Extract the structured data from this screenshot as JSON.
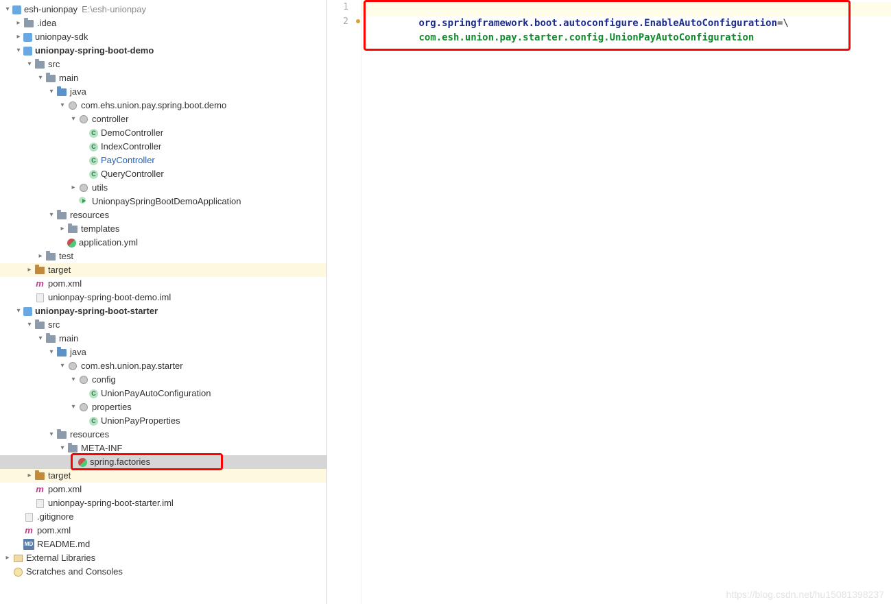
{
  "project": {
    "root_name": "esh-unionpay",
    "root_path": "E:\\esh-unionpay",
    "idea": ".idea",
    "sdk": "unionpay-sdk",
    "demo": "unionpay-spring-boot-demo",
    "src": "src",
    "main": "main",
    "java": "java",
    "pkg_demo": "com.ehs.union.pay.spring.boot.demo",
    "controller": "controller",
    "demo_ctl": "DemoController",
    "index_ctl": "IndexController",
    "pay_ctl": "PayController",
    "query_ctl": "QueryController",
    "utils": "utils",
    "demo_app": "UnionpaySpringBootDemoApplication",
    "resources": "resources",
    "templates": "templates",
    "app_yml": "application.yml",
    "test": "test",
    "target": "target",
    "pom": "pom.xml",
    "demo_iml": "unionpay-spring-boot-demo.iml",
    "starter": "unionpay-spring-boot-starter",
    "pkg_starter": "com.esh.union.pay.starter",
    "config": "config",
    "auto_cfg": "UnionPayAutoConfiguration",
    "properties": "properties",
    "union_props": "UnionPayProperties",
    "metainf": "META-INF",
    "spring_fac": "spring.factories",
    "starter_iml": "unionpay-spring-boot-starter.iml",
    "gitignore": ".gitignore",
    "readme": "README.md",
    "ext_libs": "External Libraries",
    "scratch": "Scratches and Consoles"
  },
  "editor": {
    "gutter": [
      "1",
      "2"
    ],
    "line1_key": "org.springframework.boot.autoconfigure.EnableAutoConfiguration",
    "line1_eq": "=\\",
    "line2": "com.esh.union.pay.starter.config.UnionPayAutoConfiguration"
  },
  "watermark": "https://blog.csdn.net/hu15081398237"
}
